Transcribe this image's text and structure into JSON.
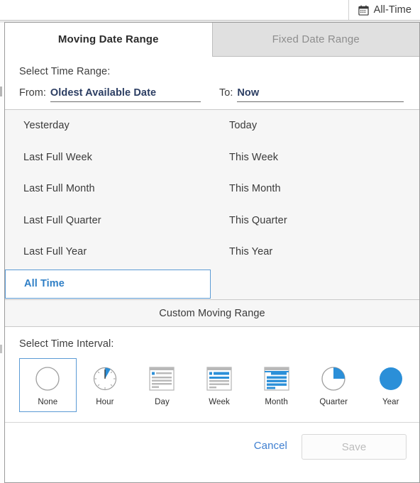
{
  "header": {
    "alltime_button_label": "All-Time",
    "calendar_icon": "calendar-icon"
  },
  "dialog": {
    "tabs": [
      {
        "label": "Moving Date Range",
        "active": true
      },
      {
        "label": "Fixed Date Range",
        "active": false
      }
    ],
    "range": {
      "section_label": "Select Time Range:",
      "from_label": "From:",
      "from_value": "Oldest Available Date",
      "to_label": "To:",
      "to_value": "Now"
    },
    "presets": [
      {
        "label": "Yesterday",
        "selected": false
      },
      {
        "label": "Today",
        "selected": false
      },
      {
        "label": "Last Full Week",
        "selected": false
      },
      {
        "label": "This Week",
        "selected": false
      },
      {
        "label": "Last Full Month",
        "selected": false
      },
      {
        "label": "This Month",
        "selected": false
      },
      {
        "label": "Last Full Quarter",
        "selected": false
      },
      {
        "label": "This Quarter",
        "selected": false
      },
      {
        "label": "Last Full Year",
        "selected": false
      },
      {
        "label": "This Year",
        "selected": false
      },
      {
        "label": "All Time",
        "selected": true
      }
    ],
    "custom_range_label": "Custom Moving Range",
    "interval": {
      "section_label": "Select Time Interval:",
      "options": [
        {
          "label": "None",
          "icon": "empty-circle-icon",
          "selected": true
        },
        {
          "label": "Hour",
          "icon": "clock-icon",
          "selected": false
        },
        {
          "label": "Day",
          "icon": "day-list-icon",
          "selected": false
        },
        {
          "label": "Week",
          "icon": "week-list-icon",
          "selected": false
        },
        {
          "label": "Month",
          "icon": "month-list-icon",
          "selected": false
        },
        {
          "label": "Quarter",
          "icon": "quarter-pie-icon",
          "selected": false
        },
        {
          "label": "Year",
          "icon": "full-circle-icon",
          "selected": false
        }
      ]
    },
    "footer": {
      "cancel_label": "Cancel",
      "save_label": "Save",
      "save_disabled": true
    }
  },
  "colors": {
    "accent_blue": "#2f7fc6",
    "link_blue": "#3f7fd0",
    "icon_blue": "#2b8fd8",
    "field_text": "#2c3e63",
    "panel_bg": "#f6f6f6",
    "border": "#9a9a9a"
  }
}
